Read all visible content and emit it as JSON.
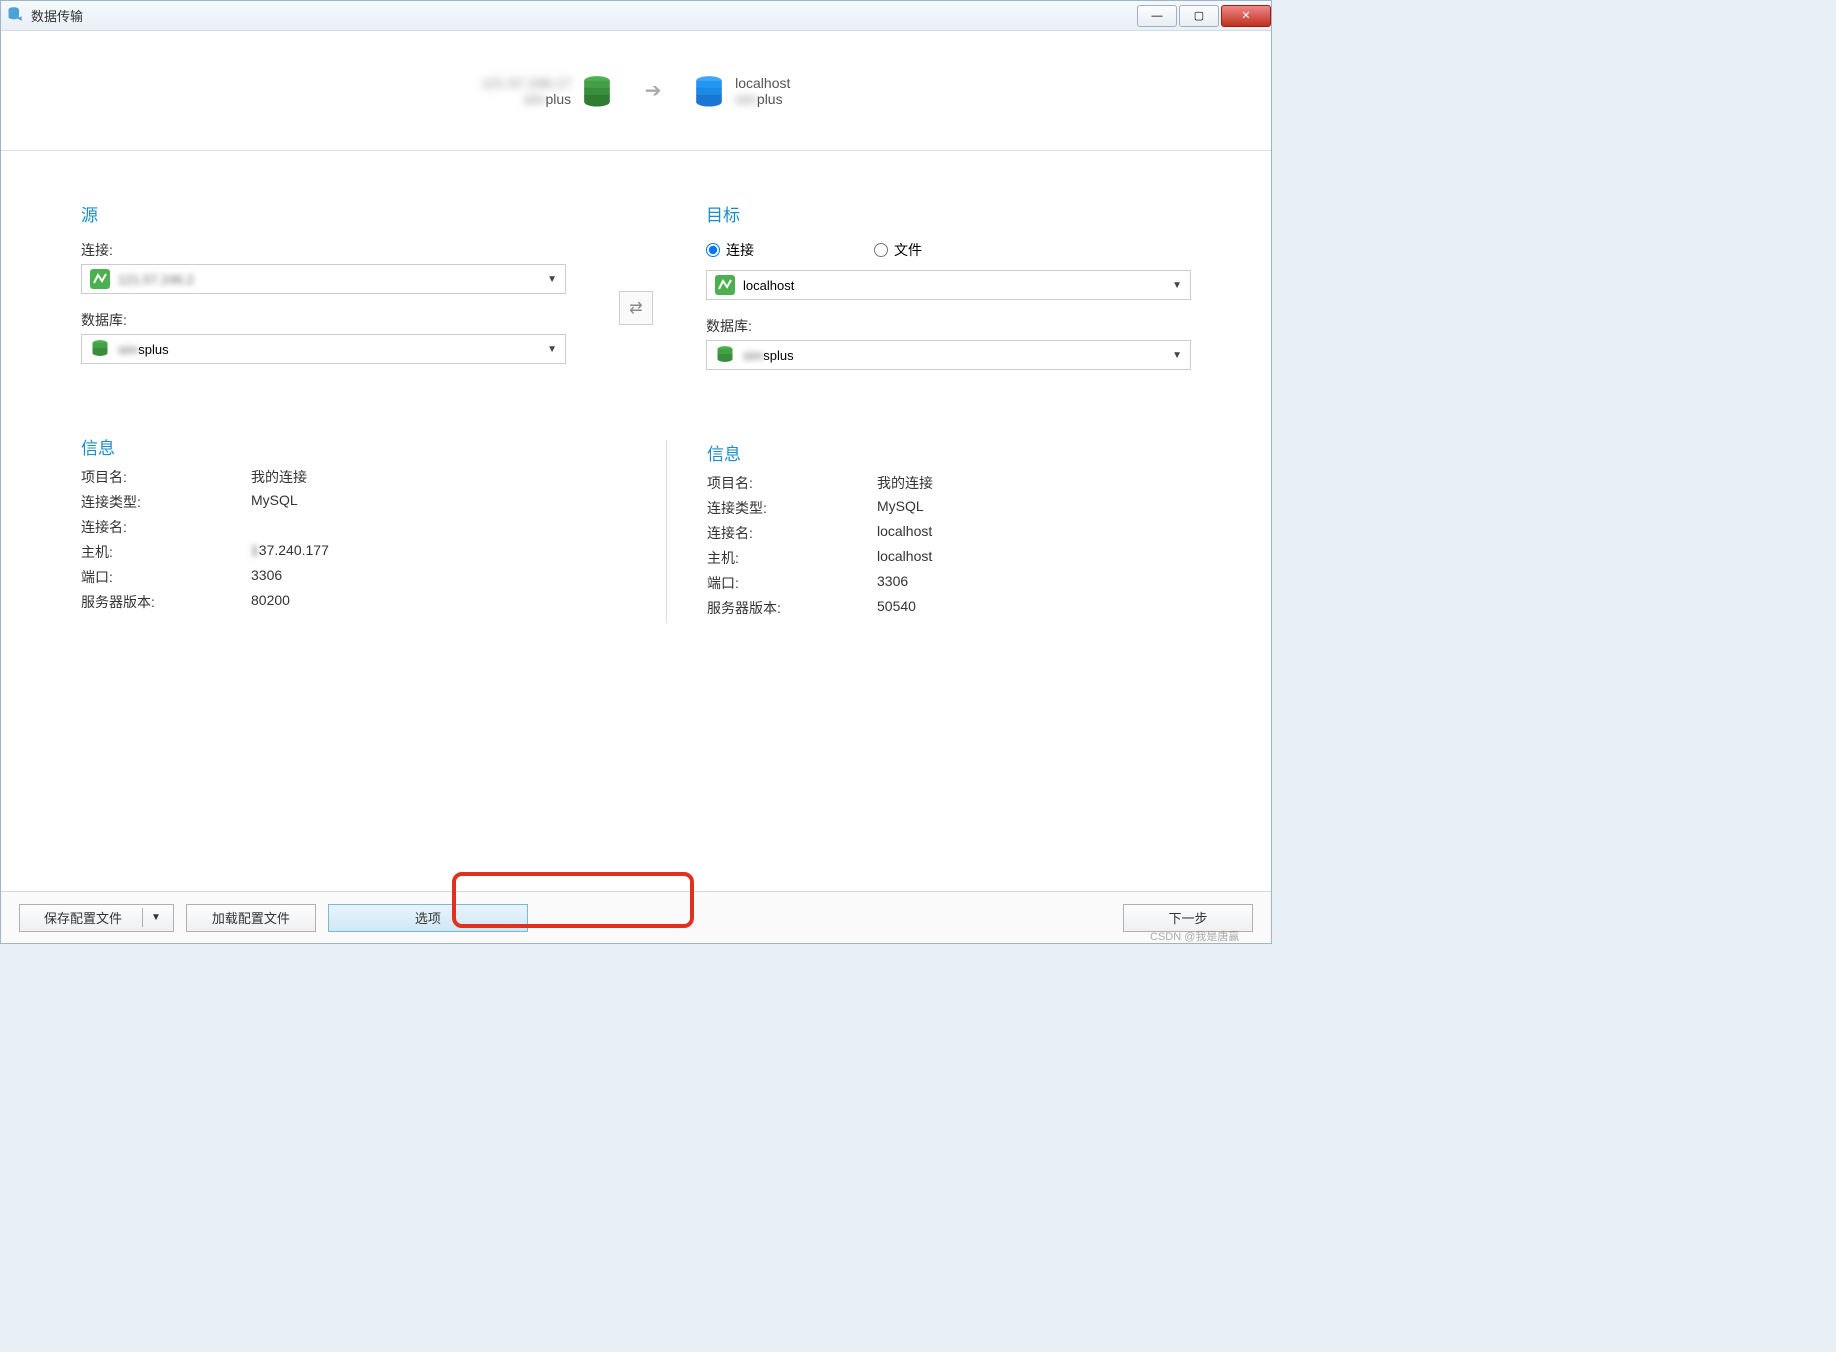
{
  "window": {
    "title": "数据传输"
  },
  "banner": {
    "source_line1": "121.57.246.17",
    "source_line2": "plus",
    "target_line1": "localhost",
    "target_line2": "plus"
  },
  "source": {
    "title": "源",
    "conn_label": "连接:",
    "conn_value": "121.57.246.2",
    "db_label": "数据库:",
    "db_value": "splus"
  },
  "target": {
    "title": "目标",
    "radio_conn": "连接",
    "radio_file": "文件",
    "conn_value": "localhost",
    "db_label": "数据库:",
    "db_value": "splus"
  },
  "info_title": "信息",
  "info_keys": {
    "project": "项目名:",
    "conn_type": "连接类型:",
    "conn_name": "连接名:",
    "host": "主机:",
    "port": "端口:",
    "server_ver": "服务器版本:"
  },
  "source_info": {
    "project": "我的连接",
    "conn_type": "MySQL",
    "conn_name": "",
    "host": "37.240.177",
    "port": "3306",
    "server_ver": "80200"
  },
  "target_info": {
    "project": "我的连接",
    "conn_type": "MySQL",
    "conn_name": "localhost",
    "host": "localhost",
    "port": "3306",
    "server_ver": "50540"
  },
  "footer": {
    "save_profile": "保存配置文件",
    "load_profile": "加载配置文件",
    "options": "选项",
    "next": "下一步"
  },
  "watermark": "CSDN @我是唐赢"
}
